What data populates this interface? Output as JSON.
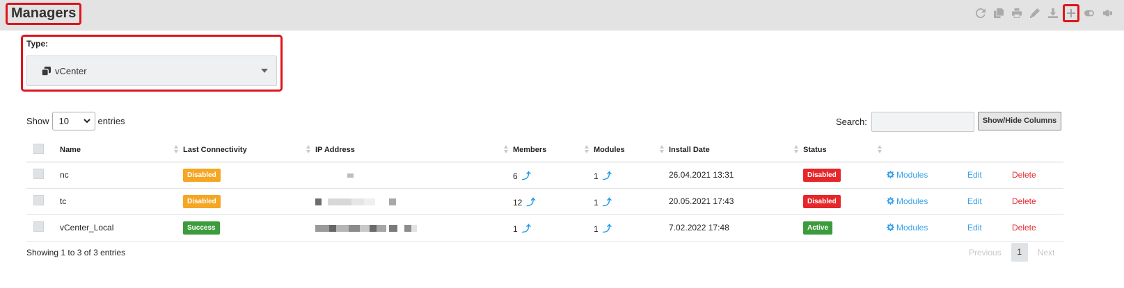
{
  "header": {
    "title": "Managers",
    "toolbar_icons": [
      "refresh-icon",
      "copy-icon",
      "print-icon",
      "edit-icon",
      "download-icon",
      "add-icon",
      "toggle-icon",
      "pin-icon"
    ]
  },
  "type_filter": {
    "label": "Type:",
    "selected": "vCenter",
    "icon": "vcenter-icon"
  },
  "length_control": {
    "prefix": "Show",
    "selected": "10",
    "suffix": "entries"
  },
  "search": {
    "label": "Search:",
    "value": ""
  },
  "colvis_button": "Show/Hide Columns",
  "table": {
    "columns": [
      "Name",
      "Last Connectivity",
      "IP Address",
      "Members",
      "Modules",
      "Install Date",
      "Status"
    ],
    "rows": [
      {
        "name": "nc",
        "connectivity": "Disabled",
        "members": "6",
        "modules": "1",
        "install_date": "26.04.2021 13:31",
        "status": "Disabled"
      },
      {
        "name": "tc",
        "connectivity": "Disabled",
        "members": "12",
        "modules": "1",
        "install_date": "20.05.2021 17:43",
        "status": "Disabled"
      },
      {
        "name": "vCenter_Local",
        "connectivity": "Success",
        "members": "1",
        "modules": "1",
        "install_date": "7.02.2022 17:48",
        "status": "Active"
      }
    ],
    "action_modules": "Modules",
    "action_edit": "Edit",
    "action_delete": "Delete",
    "arrow_glyph": "⤴"
  },
  "footer": {
    "info": "Showing 1 to 3 of 3 entries",
    "previous": "Previous",
    "current_page": "1",
    "next": "Next"
  },
  "colors": {
    "highlight": "#e0141b",
    "link": "#3aa2e8",
    "danger": "#e5262b",
    "warning": "#f5a623",
    "success": "#3c9b3c"
  }
}
